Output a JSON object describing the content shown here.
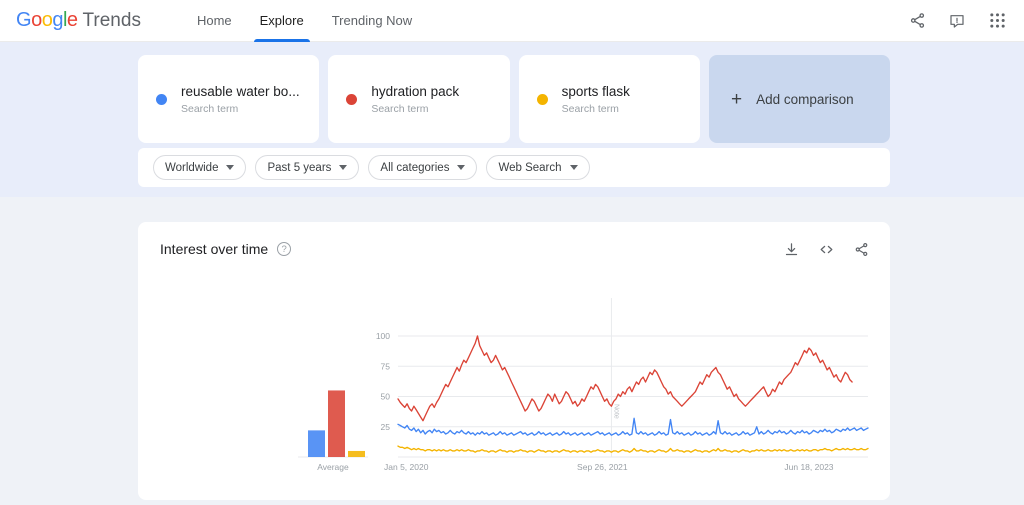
{
  "nav": {
    "brand_google": "Google",
    "brand_word": "Trends",
    "links": [
      {
        "label": "Home",
        "active": false
      },
      {
        "label": "Explore",
        "active": true
      },
      {
        "label": "Trending Now",
        "active": false
      }
    ],
    "icons": [
      {
        "name": "share-icon",
        "label": "Share"
      },
      {
        "name": "feedback-icon",
        "label": "Send feedback"
      },
      {
        "name": "apps-grid-icon",
        "label": "Google apps"
      }
    ]
  },
  "comparison": {
    "cards": [
      {
        "term": "reusable water bo...",
        "subtitle": "Search term",
        "color": "#4285F4"
      },
      {
        "term": "hydration pack",
        "subtitle": "Search term",
        "color": "#DB4437"
      },
      {
        "term": "sports flask",
        "subtitle": "Search term",
        "color": "#F4B400"
      }
    ],
    "add_label": "Add comparison",
    "add_plus": "+"
  },
  "filters": [
    {
      "name": "location-filter",
      "label": "Worldwide"
    },
    {
      "name": "time-range-filter",
      "label": "Past 5 years"
    },
    {
      "name": "category-filter",
      "label": "All categories"
    },
    {
      "name": "search-type-filter",
      "label": "Web Search"
    }
  ],
  "panel": {
    "title": "Interest over time",
    "help_glyph": "?",
    "actions": [
      {
        "name": "download-csv-icon",
        "label": "Download CSV"
      },
      {
        "name": "embed-code-icon",
        "label": "Embed"
      },
      {
        "name": "share-chart-icon",
        "label": "Share"
      }
    ],
    "average_label": "Average",
    "note_marker": "Note"
  },
  "chart_data": {
    "type": "line",
    "title": "Interest over time",
    "xlabel": "",
    "ylabel": "",
    "ylim": [
      0,
      100
    ],
    "grid": true,
    "legend_position": "cards-above",
    "ytick_labels": [
      "25",
      "50",
      "75",
      "100"
    ],
    "yticks": [
      25,
      50,
      75,
      100
    ],
    "xtick_labels": [
      "Jan 5, 2020",
      "Sep 26, 2021",
      "Jun 18, 2023"
    ],
    "xticks": [
      0,
      90,
      181
    ],
    "note_line_index": 94,
    "series": [
      {
        "name": "reusable water bo...",
        "color": "#4285F4",
        "average": 22,
        "values": [
          27,
          26,
          25,
          24,
          26,
          23,
          22,
          24,
          21,
          23,
          20,
          22,
          19,
          21,
          22,
          20,
          23,
          21,
          22,
          20,
          21,
          19,
          20,
          22,
          20,
          19,
          21,
          20,
          22,
          20,
          19,
          21,
          19,
          20,
          18,
          20,
          19,
          21,
          19,
          20,
          18,
          19,
          20,
          18,
          19,
          21,
          19,
          20,
          18,
          19,
          20,
          18,
          19,
          20,
          21,
          19,
          20,
          18,
          19,
          20,
          18,
          19,
          21,
          19,
          20,
          18,
          19,
          20,
          18,
          19,
          20,
          18,
          19,
          21,
          19,
          20,
          18,
          19,
          20,
          18,
          19,
          20,
          18,
          19,
          20,
          18,
          19,
          20,
          21,
          19,
          20,
          18,
          19,
          20,
          18,
          19,
          20,
          18,
          19,
          21,
          19,
          20,
          18,
          19,
          32,
          20,
          19,
          21,
          19,
          20,
          18,
          19,
          20,
          18,
          19,
          21,
          19,
          20,
          18,
          19,
          31,
          20,
          19,
          21,
          19,
          20,
          18,
          19,
          20,
          18,
          19,
          21,
          19,
          20,
          18,
          19,
          20,
          18,
          19,
          21,
          19,
          30,
          20,
          19,
          21,
          19,
          20,
          18,
          19,
          20,
          18,
          19,
          21,
          19,
          20,
          18,
          19,
          20,
          25,
          19,
          21,
          19,
          20,
          22,
          20,
          19,
          21,
          20,
          22,
          20,
          21,
          19,
          20,
          22,
          20,
          19,
          21,
          20,
          22,
          20,
          21,
          19,
          20,
          22,
          21,
          20,
          22,
          21,
          23,
          21,
          22,
          20,
          21,
          23,
          22,
          21,
          23,
          22,
          24,
          22,
          23,
          24,
          22,
          23,
          24,
          22,
          23,
          24
        ]
      },
      {
        "name": "hydration pack",
        "color": "#DB4437",
        "average": 55,
        "values": [
          48,
          45,
          43,
          41,
          44,
          40,
          38,
          42,
          39,
          36,
          33,
          30,
          34,
          38,
          42,
          44,
          41,
          45,
          48,
          52,
          56,
          60,
          58,
          62,
          66,
          70,
          74,
          71,
          76,
          80,
          78,
          82,
          86,
          90,
          94,
          100,
          92,
          88,
          84,
          86,
          82,
          78,
          80,
          84,
          80,
          76,
          72,
          74,
          70,
          66,
          62,
          58,
          54,
          50,
          46,
          42,
          38,
          40,
          44,
          48,
          46,
          42,
          38,
          40,
          44,
          48,
          52,
          50,
          46,
          52,
          48,
          44,
          46,
          50,
          54,
          52,
          48,
          44,
          46,
          42,
          44,
          48,
          46,
          50,
          54,
          58,
          56,
          60,
          58,
          54,
          50,
          46,
          48,
          44,
          42,
          46,
          48,
          52,
          50,
          54,
          52,
          56,
          58,
          54,
          58,
          62,
          60,
          64,
          66,
          62,
          66,
          70,
          68,
          72,
          70,
          66,
          62,
          58,
          56,
          52,
          54,
          50,
          48,
          46,
          44,
          42,
          44,
          46,
          48,
          50,
          52,
          54,
          58,
          62,
          60,
          64,
          68,
          66,
          70,
          72,
          74,
          70,
          68,
          64,
          60,
          56,
          58,
          54,
          50,
          52,
          48,
          46,
          44,
          42,
          44,
          46,
          48,
          50,
          52,
          54,
          56,
          58,
          54,
          50,
          52,
          56,
          54,
          58,
          62,
          60,
          64,
          66,
          68,
          70,
          74,
          78,
          76,
          80,
          84,
          88,
          86,
          90,
          88,
          84,
          86,
          82,
          78,
          80,
          76,
          72,
          74,
          70,
          66,
          68,
          64,
          62,
          66,
          70,
          68,
          64,
          62
        ]
      },
      {
        "name": "sports flask",
        "color": "#F4B400",
        "average": 5,
        "values": [
          9,
          8,
          8,
          7,
          8,
          7,
          6,
          7,
          6,
          7,
          6,
          6,
          5,
          6,
          6,
          5,
          6,
          5,
          6,
          5,
          6,
          5,
          5,
          6,
          5,
          5,
          6,
          5,
          6,
          5,
          5,
          6,
          5,
          5,
          4,
          5,
          5,
          6,
          5,
          5,
          4,
          5,
          5,
          4,
          5,
          6,
          5,
          5,
          4,
          5,
          5,
          4,
          5,
          5,
          6,
          5,
          5,
          4,
          5,
          5,
          4,
          5,
          6,
          5,
          5,
          4,
          5,
          5,
          4,
          5,
          5,
          4,
          5,
          6,
          5,
          5,
          4,
          5,
          5,
          4,
          5,
          5,
          4,
          5,
          5,
          4,
          5,
          5,
          6,
          5,
          5,
          4,
          5,
          5,
          4,
          5,
          5,
          4,
          5,
          6,
          5,
          5,
          4,
          5,
          7,
          5,
          5,
          6,
          5,
          5,
          4,
          5,
          5,
          4,
          5,
          6,
          5,
          5,
          4,
          5,
          7,
          5,
          5,
          6,
          5,
          5,
          4,
          5,
          5,
          4,
          5,
          6,
          5,
          5,
          4,
          5,
          5,
          4,
          5,
          6,
          5,
          7,
          5,
          5,
          6,
          5,
          5,
          4,
          5,
          5,
          4,
          5,
          6,
          5,
          5,
          4,
          5,
          5,
          6,
          5,
          6,
          5,
          5,
          6,
          5,
          5,
          6,
          5,
          6,
          5,
          6,
          5,
          5,
          6,
          5,
          5,
          6,
          5,
          6,
          5,
          6,
          5,
          5,
          6,
          6,
          5,
          6,
          6,
          7,
          6,
          6,
          5,
          6,
          7,
          6,
          6,
          7,
          6,
          7,
          6,
          6,
          7,
          6,
          6,
          7,
          6,
          6,
          7
        ]
      }
    ]
  }
}
